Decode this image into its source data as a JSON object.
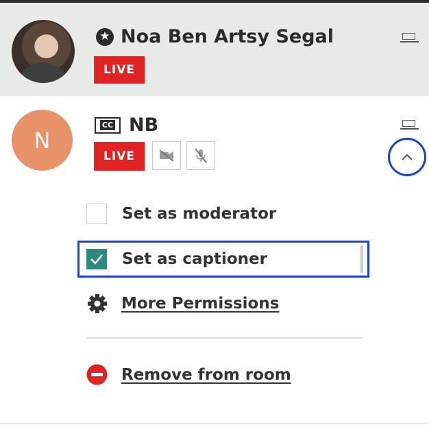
{
  "participants": [
    {
      "name": "Noa Ben Artsy Segal",
      "role_icon": "star-badge-icon",
      "status": "LIVE",
      "avatar": "photo",
      "device_icon": "laptop-icon"
    },
    {
      "name": "NB",
      "avatar_initial": "N",
      "role_icon": "closed-captions-icon",
      "status": "LIVE",
      "video_state_icon": "video-off-icon",
      "audio_state_icon": "mic-off-icon",
      "device_icon": "laptop-icon",
      "expand_icon": "chevron-up-icon"
    }
  ],
  "menu": {
    "set_moderator": {
      "label": "Set as moderator",
      "checked": false
    },
    "set_captioner": {
      "label": "Set as captioner",
      "checked": true
    },
    "more_permissions": {
      "label": "More Permissions",
      "icon": "gear-icon"
    },
    "remove_from_room": {
      "label": "Remove from room",
      "icon": "remove-circle-icon"
    }
  },
  "colors": {
    "live_badge": "#e02424",
    "focus_ring": "#1f3fd0",
    "checkbox_checked": "#2a8a80",
    "avatar_n": "#e8926a",
    "selected_row_bg": "#e8eaea",
    "remove_icon": "#e02424"
  }
}
